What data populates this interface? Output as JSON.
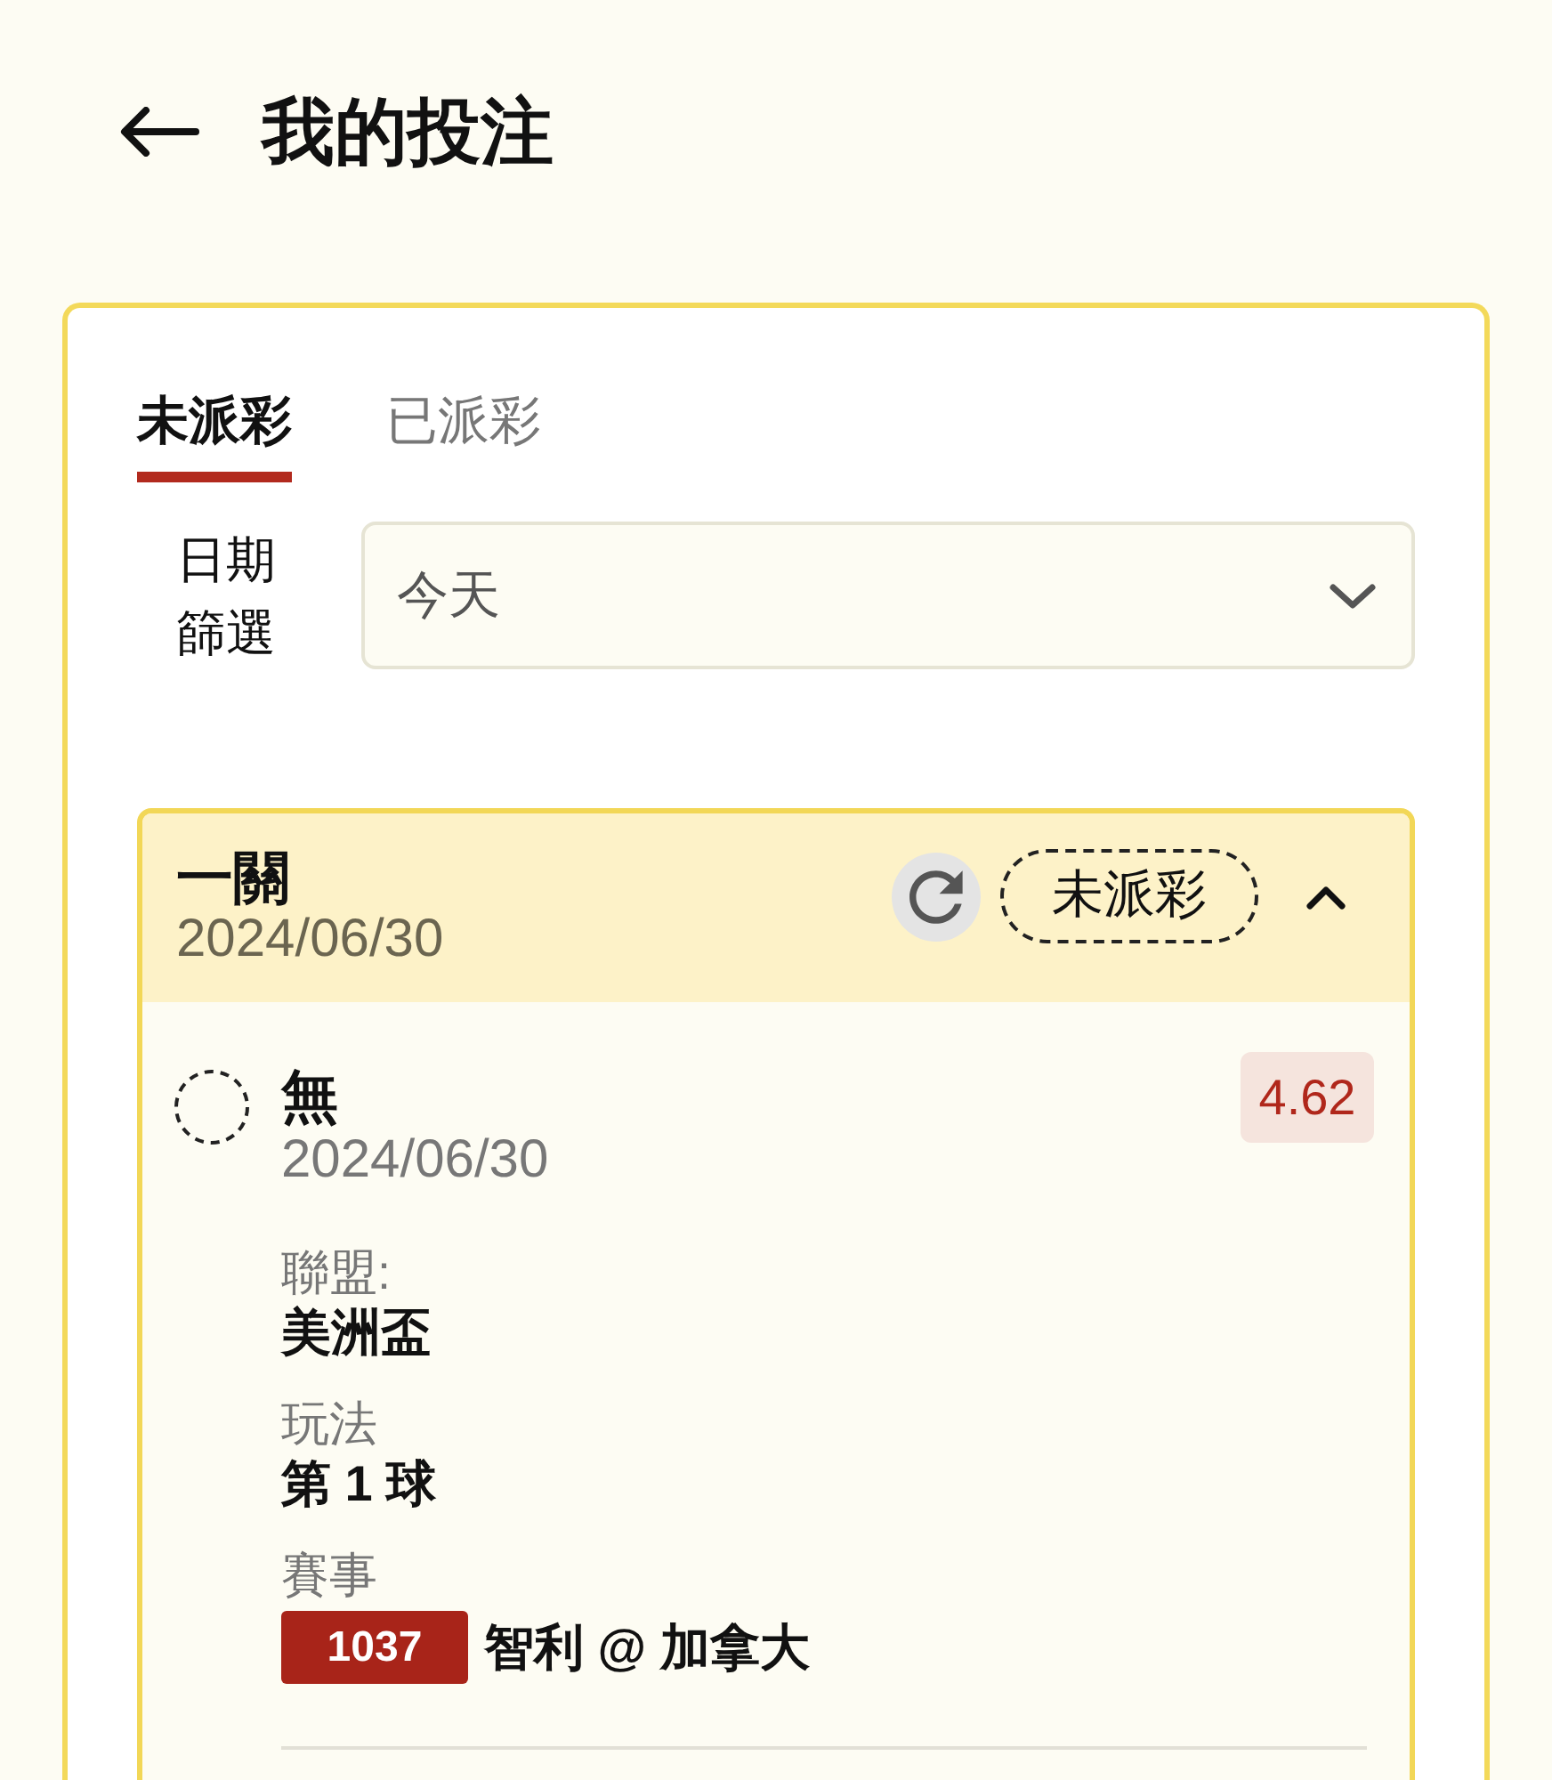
{
  "header": {
    "title": "我的投注"
  },
  "tabs": [
    {
      "label": "未派彩",
      "selected": true
    },
    {
      "label": "已派彩",
      "selected": false
    }
  ],
  "date_filter": {
    "label": "日期篩選",
    "value": "今天"
  },
  "bets": [
    {
      "type": "一關",
      "date": "2024/06/30",
      "status": "未派彩",
      "expanded": true,
      "selections": [
        {
          "name": "無",
          "date": "2024/06/30",
          "pending": true,
          "odds": "4.62",
          "details": [
            {
              "kind": "text",
              "label": "聯盟:",
              "value": "美洲盃"
            },
            {
              "kind": "text",
              "label": "玩法",
              "value": "第 1 球"
            },
            {
              "kind": "match",
              "label": "賽事",
              "number": "1037",
              "teams": "智利 @ 加拿大"
            }
          ]
        }
      ]
    }
  ]
}
